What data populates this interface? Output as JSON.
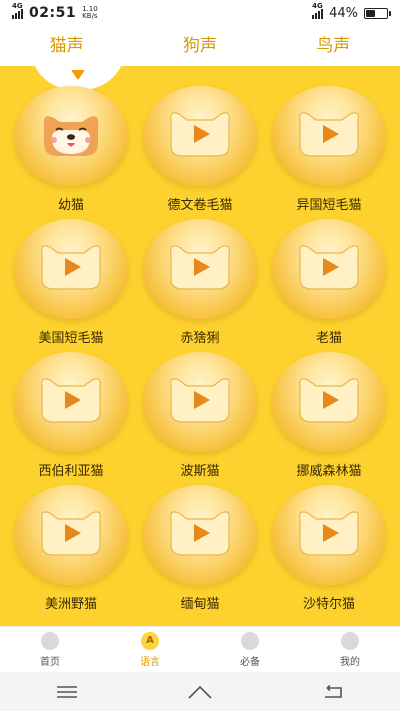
{
  "status": {
    "network_type": "4G",
    "time": "02:51",
    "speed_value": "1.10",
    "speed_unit": "KB/s",
    "right_network": "4G",
    "battery": "44%",
    "battery_level": 0.44
  },
  "tabs": [
    {
      "label": "猫声",
      "active": true
    },
    {
      "label": "狗声",
      "active": false
    },
    {
      "label": "鸟声",
      "active": false
    }
  ],
  "grid": {
    "items": [
      {
        "label": "幼猫",
        "icon": "shiba-dog-face-icon"
      },
      {
        "label": "德文卷毛猫",
        "icon": "play-icon"
      },
      {
        "label": "异国短毛猫",
        "icon": "play-icon"
      },
      {
        "label": "美国短毛猫",
        "icon": "play-icon"
      },
      {
        "label": "赤猞猁",
        "icon": "play-icon"
      },
      {
        "label": "老猫",
        "icon": "play-icon"
      },
      {
        "label": "西伯利亚猫",
        "icon": "play-icon"
      },
      {
        "label": "波斯猫",
        "icon": "play-icon"
      },
      {
        "label": "挪威森林猫",
        "icon": "play-icon"
      },
      {
        "label": "美洲野猫",
        "icon": "play-icon"
      },
      {
        "label": "缅甸猫",
        "icon": "play-icon"
      },
      {
        "label": "沙特尔猫",
        "icon": "play-icon"
      }
    ]
  },
  "bottom_nav": [
    {
      "label": "首页",
      "icon_glyph": "",
      "active": false
    },
    {
      "label": "语言",
      "icon_glyph": "A",
      "active": true
    },
    {
      "label": "必备",
      "icon_glyph": "",
      "active": false
    },
    {
      "label": "我的",
      "icon_glyph": "",
      "active": false
    }
  ],
  "colors": {
    "accent": "#fdd22e",
    "tab_text": "#d99a00",
    "active_nav": "#e29a00"
  }
}
